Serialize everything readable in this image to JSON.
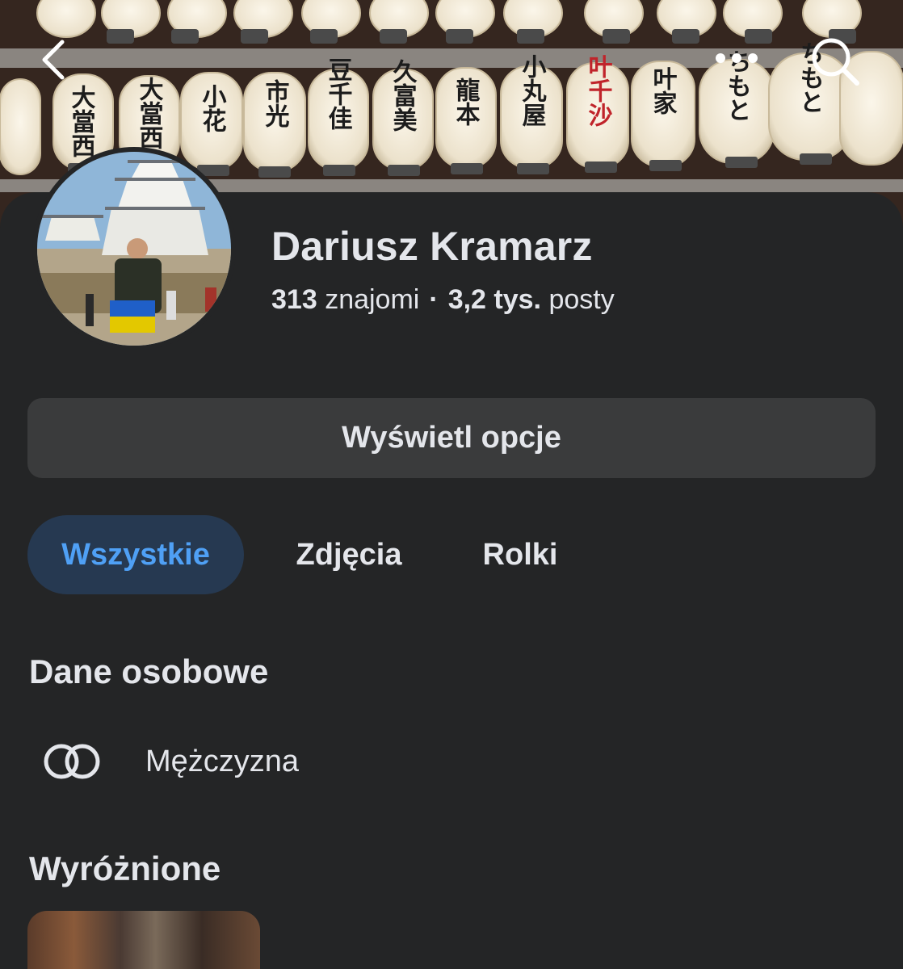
{
  "profile": {
    "name": "Dariusz Kramarz",
    "friends_count": "313",
    "friends_label": "znajomi",
    "separator": "·",
    "posts_count": "3,2 tys.",
    "posts_label": "posty"
  },
  "actions": {
    "view_options": "Wyświetl opcje"
  },
  "tabs": [
    {
      "label": "Wszystkie",
      "active": true
    },
    {
      "label": "Zdjęcia",
      "active": false
    },
    {
      "label": "Rolki",
      "active": false
    }
  ],
  "personal_data": {
    "title": "Dane osobowe",
    "gender": "Mężczyzna",
    "gender_icon": "intersecting-rings-icon"
  },
  "featured": {
    "title": "Wyróżnione"
  },
  "cover_lanterns": [
    {
      "text": "大當西"
    },
    {
      "text": "大當西"
    },
    {
      "text": "小花"
    },
    {
      "text": "市光"
    },
    {
      "text": "豆千佳"
    },
    {
      "text": "久富美"
    },
    {
      "text": "龍本"
    },
    {
      "text": "小丸屋"
    },
    {
      "text": "叶千沙"
    },
    {
      "text": "叶家"
    },
    {
      "text": "ちもと"
    },
    {
      "text": "ちもと"
    }
  ],
  "icons": {
    "back": "chevron-left-icon",
    "more": "more-dots-icon",
    "search": "search-icon"
  },
  "colors": {
    "background": "#242526",
    "tab_active_bg": "#263951",
    "tab_active_text": "#4fa0f5",
    "button_bg": "#3a3b3c",
    "text": "#e4e6eb"
  }
}
